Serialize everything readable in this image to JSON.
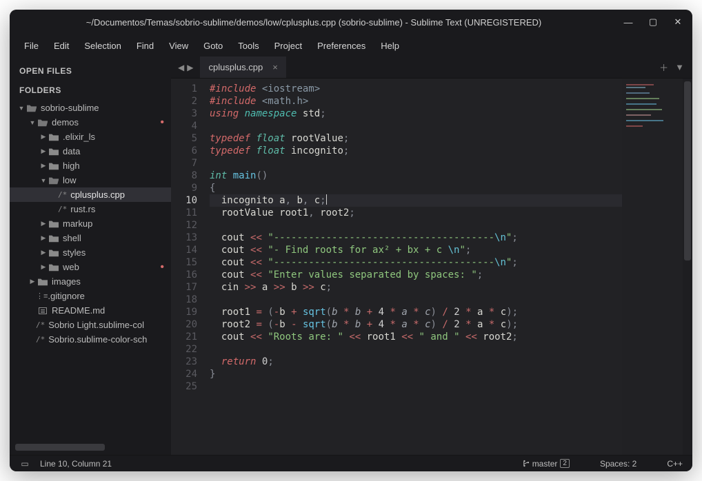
{
  "title": "~/Documentos/Temas/sobrio-sublime/demos/low/cplusplus.cpp (sobrio-sublime) - Sublime Text (UNREGISTERED)",
  "menu": [
    "File",
    "Edit",
    "Selection",
    "Find",
    "View",
    "Goto",
    "Tools",
    "Project",
    "Preferences",
    "Help"
  ],
  "sidebar": {
    "open_files_h": "OPEN FILES",
    "folders_h": "FOLDERS",
    "tree": [
      {
        "d": 0,
        "t": "folder-open",
        "arr": "▼",
        "label": "sobrio-sublime"
      },
      {
        "d": 1,
        "t": "folder-open",
        "arr": "▼",
        "label": "demos",
        "dot": true
      },
      {
        "d": 2,
        "t": "folder",
        "arr": "▶",
        "label": ".elixir_ls"
      },
      {
        "d": 2,
        "t": "folder",
        "arr": "▶",
        "label": "data"
      },
      {
        "d": 2,
        "t": "folder",
        "arr": "▶",
        "label": "high"
      },
      {
        "d": 2,
        "t": "folder-open",
        "arr": "▼",
        "label": "low"
      },
      {
        "d": 3,
        "t": "file-code",
        "label": "cplusplus.cpp",
        "sel": true
      },
      {
        "d": 3,
        "t": "file-code",
        "label": "rust.rs"
      },
      {
        "d": 2,
        "t": "folder",
        "arr": "▶",
        "label": "markup"
      },
      {
        "d": 2,
        "t": "folder",
        "arr": "▶",
        "label": "shell"
      },
      {
        "d": 2,
        "t": "folder",
        "arr": "▶",
        "label": "styles"
      },
      {
        "d": 2,
        "t": "folder",
        "arr": "▶",
        "label": "web",
        "dot": true
      },
      {
        "d": 1,
        "t": "folder",
        "arr": "▶",
        "label": "images"
      },
      {
        "d": 1,
        "t": "file-git",
        "label": ".gitignore"
      },
      {
        "d": 1,
        "t": "file-md",
        "label": "README.md"
      },
      {
        "d": 1,
        "t": "file-code",
        "label": "Sobrio Light.sublime-col"
      },
      {
        "d": 1,
        "t": "file-code",
        "label": "Sobrio.sublime-color-sch"
      }
    ]
  },
  "tab": {
    "name": "cplusplus.cpp"
  },
  "gutter_lines": 25,
  "current_line": 10,
  "code": [
    [
      {
        "c": "kw-red",
        "t": "#include"
      },
      {
        "c": "p",
        "t": " "
      },
      {
        "c": "inc",
        "t": "<iostream>"
      }
    ],
    [
      {
        "c": "kw-red",
        "t": "#include"
      },
      {
        "c": "p",
        "t": " "
      },
      {
        "c": "inc",
        "t": "<math.h>"
      }
    ],
    [
      {
        "c": "kw-red",
        "t": "using"
      },
      {
        "c": "p",
        "t": " "
      },
      {
        "c": "kw-teal",
        "t": "namespace"
      },
      {
        "c": "p",
        "t": " "
      },
      {
        "c": "ident",
        "t": "std"
      },
      {
        "c": "p",
        "t": ";"
      }
    ],
    [],
    [
      {
        "c": "kw-red",
        "t": "typedef"
      },
      {
        "c": "p",
        "t": " "
      },
      {
        "c": "type",
        "t": "float"
      },
      {
        "c": "p",
        "t": " "
      },
      {
        "c": "ident",
        "t": "rootValue"
      },
      {
        "c": "p",
        "t": ";"
      }
    ],
    [
      {
        "c": "kw-red",
        "t": "typedef"
      },
      {
        "c": "p",
        "t": " "
      },
      {
        "c": "type",
        "t": "float"
      },
      {
        "c": "p",
        "t": " "
      },
      {
        "c": "ident",
        "t": "incognito"
      },
      {
        "c": "p",
        "t": ";"
      }
    ],
    [],
    [
      {
        "c": "type",
        "t": "int"
      },
      {
        "c": "p",
        "t": " "
      },
      {
        "c": "fn",
        "t": "main"
      },
      {
        "c": "p",
        "t": "()"
      }
    ],
    [
      {
        "c": "p",
        "t": "{"
      }
    ],
    [
      {
        "c": "p",
        "t": "  "
      },
      {
        "c": "ident",
        "t": "incognito a"
      },
      {
        "c": "p",
        "t": ", "
      },
      {
        "c": "ident",
        "t": "b"
      },
      {
        "c": "p",
        "t": ", "
      },
      {
        "c": "ident",
        "t": "c"
      },
      {
        "c": "p",
        "t": ";"
      },
      {
        "caret": true
      }
    ],
    [
      {
        "c": "p",
        "t": "  "
      },
      {
        "c": "ident",
        "t": "rootValue root1"
      },
      {
        "c": "p",
        "t": ", "
      },
      {
        "c": "ident",
        "t": "root2"
      },
      {
        "c": "p",
        "t": ";"
      }
    ],
    [],
    [
      {
        "c": "p",
        "t": "  "
      },
      {
        "c": "ident",
        "t": "cout"
      },
      {
        "c": "p",
        "t": " "
      },
      {
        "c": "op",
        "t": "<<"
      },
      {
        "c": "p",
        "t": " "
      },
      {
        "c": "str",
        "t": "\"--------------------------------------"
      },
      {
        "c": "esc",
        "t": "\\n"
      },
      {
        "c": "str",
        "t": "\""
      },
      {
        "c": "p",
        "t": ";"
      }
    ],
    [
      {
        "c": "p",
        "t": "  "
      },
      {
        "c": "ident",
        "t": "cout"
      },
      {
        "c": "p",
        "t": " "
      },
      {
        "c": "op",
        "t": "<<"
      },
      {
        "c": "p",
        "t": " "
      },
      {
        "c": "str",
        "t": "\"- Find roots for ax² + bx + c "
      },
      {
        "c": "esc",
        "t": "\\n"
      },
      {
        "c": "str",
        "t": "\""
      },
      {
        "c": "p",
        "t": ";"
      }
    ],
    [
      {
        "c": "p",
        "t": "  "
      },
      {
        "c": "ident",
        "t": "cout"
      },
      {
        "c": "p",
        "t": " "
      },
      {
        "c": "op",
        "t": "<<"
      },
      {
        "c": "p",
        "t": " "
      },
      {
        "c": "str",
        "t": "\"--------------------------------------"
      },
      {
        "c": "esc",
        "t": "\\n"
      },
      {
        "c": "str",
        "t": "\""
      },
      {
        "c": "p",
        "t": ";"
      }
    ],
    [
      {
        "c": "p",
        "t": "  "
      },
      {
        "c": "ident",
        "t": "cout"
      },
      {
        "c": "p",
        "t": " "
      },
      {
        "c": "op",
        "t": "<<"
      },
      {
        "c": "p",
        "t": " "
      },
      {
        "c": "str",
        "t": "\"Enter values separated by spaces: \""
      },
      {
        "c": "p",
        "t": ";"
      }
    ],
    [
      {
        "c": "p",
        "t": "  "
      },
      {
        "c": "ident",
        "t": "cin"
      },
      {
        "c": "p",
        "t": " "
      },
      {
        "c": "op",
        "t": ">>"
      },
      {
        "c": "p",
        "t": " "
      },
      {
        "c": "ident",
        "t": "a"
      },
      {
        "c": "p",
        "t": " "
      },
      {
        "c": "op",
        "t": ">>"
      },
      {
        "c": "p",
        "t": " "
      },
      {
        "c": "ident",
        "t": "b"
      },
      {
        "c": "p",
        "t": " "
      },
      {
        "c": "op",
        "t": ">>"
      },
      {
        "c": "p",
        "t": " "
      },
      {
        "c": "ident",
        "t": "c"
      },
      {
        "c": "p",
        "t": ";"
      }
    ],
    [],
    [
      {
        "c": "p",
        "t": "  "
      },
      {
        "c": "ident",
        "t": "root1"
      },
      {
        "c": "p",
        "t": " "
      },
      {
        "c": "op",
        "t": "="
      },
      {
        "c": "p",
        "t": " ("
      },
      {
        "c": "op",
        "t": "-"
      },
      {
        "c": "ident",
        "t": "b"
      },
      {
        "c": "p",
        "t": " "
      },
      {
        "c": "op",
        "t": "+"
      },
      {
        "c": "p",
        "t": " "
      },
      {
        "c": "fn",
        "t": "sqrt"
      },
      {
        "c": "p",
        "t": "("
      },
      {
        "c": "var-it",
        "t": "b"
      },
      {
        "c": "p",
        "t": " "
      },
      {
        "c": "op",
        "t": "*"
      },
      {
        "c": "p",
        "t": " "
      },
      {
        "c": "var-it",
        "t": "b"
      },
      {
        "c": "p",
        "t": " "
      },
      {
        "c": "op",
        "t": "+"
      },
      {
        "c": "p",
        "t": " "
      },
      {
        "c": "num",
        "t": "4"
      },
      {
        "c": "p",
        "t": " "
      },
      {
        "c": "op",
        "t": "*"
      },
      {
        "c": "p",
        "t": " "
      },
      {
        "c": "var-it",
        "t": "a"
      },
      {
        "c": "p",
        "t": " "
      },
      {
        "c": "op",
        "t": "*"
      },
      {
        "c": "p",
        "t": " "
      },
      {
        "c": "var-it",
        "t": "c"
      },
      {
        "c": "p",
        "t": ") "
      },
      {
        "c": "op",
        "t": "/"
      },
      {
        "c": "p",
        "t": " "
      },
      {
        "c": "num",
        "t": "2"
      },
      {
        "c": "p",
        "t": " "
      },
      {
        "c": "op",
        "t": "*"
      },
      {
        "c": "p",
        "t": " "
      },
      {
        "c": "ident",
        "t": "a"
      },
      {
        "c": "p",
        "t": " "
      },
      {
        "c": "op",
        "t": "*"
      },
      {
        "c": "p",
        "t": " "
      },
      {
        "c": "ident",
        "t": "c"
      },
      {
        "c": "p",
        "t": ");"
      }
    ],
    [
      {
        "c": "p",
        "t": "  "
      },
      {
        "c": "ident",
        "t": "root2"
      },
      {
        "c": "p",
        "t": " "
      },
      {
        "c": "op",
        "t": "="
      },
      {
        "c": "p",
        "t": " ("
      },
      {
        "c": "op",
        "t": "-"
      },
      {
        "c": "ident",
        "t": "b"
      },
      {
        "c": "p",
        "t": " "
      },
      {
        "c": "op",
        "t": "-"
      },
      {
        "c": "p",
        "t": " "
      },
      {
        "c": "fn",
        "t": "sqrt"
      },
      {
        "c": "p",
        "t": "("
      },
      {
        "c": "var-it",
        "t": "b"
      },
      {
        "c": "p",
        "t": " "
      },
      {
        "c": "op",
        "t": "*"
      },
      {
        "c": "p",
        "t": " "
      },
      {
        "c": "var-it",
        "t": "b"
      },
      {
        "c": "p",
        "t": " "
      },
      {
        "c": "op",
        "t": "+"
      },
      {
        "c": "p",
        "t": " "
      },
      {
        "c": "num",
        "t": "4"
      },
      {
        "c": "p",
        "t": " "
      },
      {
        "c": "op",
        "t": "*"
      },
      {
        "c": "p",
        "t": " "
      },
      {
        "c": "var-it",
        "t": "a"
      },
      {
        "c": "p",
        "t": " "
      },
      {
        "c": "op",
        "t": "*"
      },
      {
        "c": "p",
        "t": " "
      },
      {
        "c": "var-it",
        "t": "c"
      },
      {
        "c": "p",
        "t": ") "
      },
      {
        "c": "op",
        "t": "/"
      },
      {
        "c": "p",
        "t": " "
      },
      {
        "c": "num",
        "t": "2"
      },
      {
        "c": "p",
        "t": " "
      },
      {
        "c": "op",
        "t": "*"
      },
      {
        "c": "p",
        "t": " "
      },
      {
        "c": "ident",
        "t": "a"
      },
      {
        "c": "p",
        "t": " "
      },
      {
        "c": "op",
        "t": "*"
      },
      {
        "c": "p",
        "t": " "
      },
      {
        "c": "ident",
        "t": "c"
      },
      {
        "c": "p",
        "t": ");"
      }
    ],
    [
      {
        "c": "p",
        "t": "  "
      },
      {
        "c": "ident",
        "t": "cout"
      },
      {
        "c": "p",
        "t": " "
      },
      {
        "c": "op",
        "t": "<<"
      },
      {
        "c": "p",
        "t": " "
      },
      {
        "c": "str",
        "t": "\"Roots are: \""
      },
      {
        "c": "p",
        "t": " "
      },
      {
        "c": "op",
        "t": "<<"
      },
      {
        "c": "p",
        "t": " "
      },
      {
        "c": "ident",
        "t": "root1"
      },
      {
        "c": "p",
        "t": " "
      },
      {
        "c": "op",
        "t": "<<"
      },
      {
        "c": "p",
        "t": " "
      },
      {
        "c": "str",
        "t": "\" and \""
      },
      {
        "c": "p",
        "t": " "
      },
      {
        "c": "op",
        "t": "<<"
      },
      {
        "c": "p",
        "t": " "
      },
      {
        "c": "ident",
        "t": "root2"
      },
      {
        "c": "p",
        "t": ";"
      }
    ],
    [],
    [
      {
        "c": "p",
        "t": "  "
      },
      {
        "c": "kw-red",
        "t": "return"
      },
      {
        "c": "p",
        "t": " "
      },
      {
        "c": "num",
        "t": "0"
      },
      {
        "c": "p",
        "t": ";"
      }
    ],
    [
      {
        "c": "p",
        "t": "}"
      }
    ],
    []
  ],
  "status": {
    "pos": "Line 10, Column 21",
    "branch": "master",
    "branch_count": "2",
    "spaces": "Spaces: 2",
    "lang": "C++"
  }
}
